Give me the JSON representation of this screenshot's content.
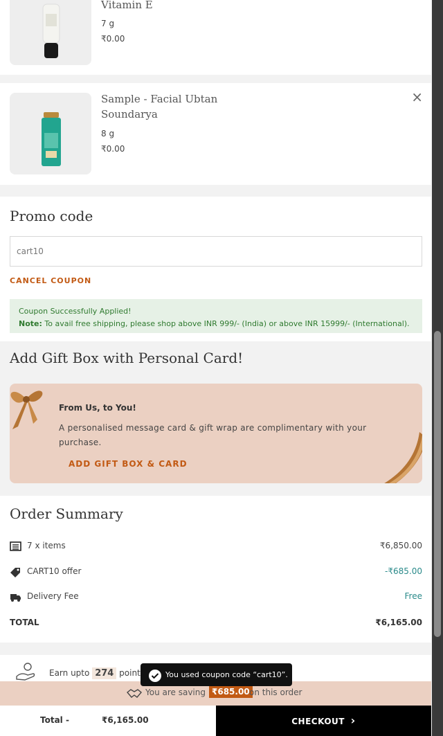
{
  "products": [
    {
      "name_line1": "Vitamin E",
      "name_line2": "",
      "weight": "7 g",
      "price": "₹0.00"
    },
    {
      "name_line1": "Sample - Facial Ubtan",
      "name_line2": "Soundarya",
      "weight": "8 g",
      "price": "₹0.00"
    }
  ],
  "remove_icon": "×",
  "promo": {
    "title": "Promo code",
    "input_value": "cart10",
    "cancel_label": "CANCEL COUPON",
    "success_message": "Coupon Successfully Applied!",
    "note_label": "Note:",
    "note_text": " To avail free shipping, please shop above INR 999/- (India) or above INR 15999/- (International)."
  },
  "gift": {
    "title": "Add Gift Box with Personal Card!",
    "card_heading": "From Us, to You!",
    "card_text": "A personalised message card & gift wrap are complimentary with your purchase.",
    "button_label": "ADD GIFT BOX & CARD"
  },
  "summary": {
    "title": "Order Summary",
    "items_label": "7 x items",
    "items_value": "₹6,850.00",
    "offer_label": "CART10 offer",
    "offer_value": "-₹685.00",
    "delivery_label": "Delivery Fee",
    "delivery_value": "Free",
    "total_label": "TOTAL",
    "total_value": "₹6,165.00"
  },
  "rewards": {
    "prefix": "Earn upto",
    "points": "274",
    "suffix": "points"
  },
  "toast": {
    "message": "You used coupon code “cart10”."
  },
  "saving": {
    "prefix": "You are saving",
    "amount": "₹685.00",
    "suffix": "on this order"
  },
  "footer": {
    "total_label": "Total -",
    "total_value": "₹6,165.00",
    "checkout_label": "CHECKOUT",
    "checkout_arrow": "›"
  },
  "colors": {
    "accent_orange": "#c25a14",
    "success_green": "#2f7a2f",
    "gift_bg": "#ebd0c2",
    "teal_value": "#2a8a8a"
  }
}
